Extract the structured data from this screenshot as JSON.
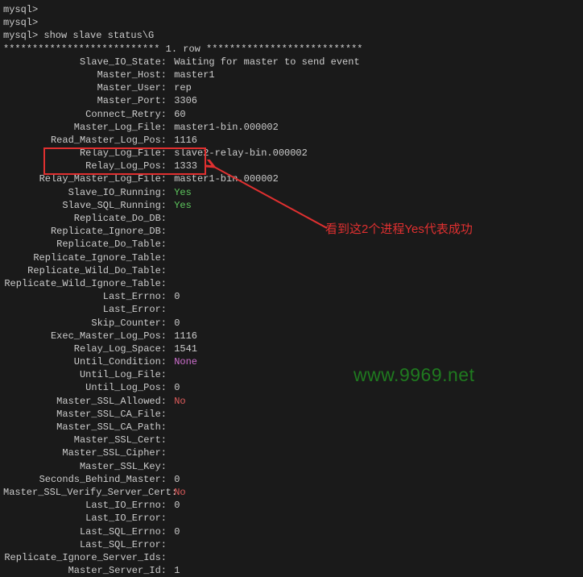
{
  "prompts": [
    "mysql>",
    "mysql>",
    "mysql> show slave status\\G"
  ],
  "row_header": "*************************** 1. row ***************************",
  "fields": [
    {
      "label": "Slave_IO_State",
      "value": "Waiting for master to send event",
      "cls": ""
    },
    {
      "label": "Master_Host",
      "value": "master1",
      "cls": ""
    },
    {
      "label": "Master_User",
      "value": "rep",
      "cls": ""
    },
    {
      "label": "Master_Port",
      "value": "3306",
      "cls": ""
    },
    {
      "label": "Connect_Retry",
      "value": "60",
      "cls": ""
    },
    {
      "label": "Master_Log_File",
      "value": "master1-bin.000002",
      "cls": ""
    },
    {
      "label": "Read_Master_Log_Pos",
      "value": "1116",
      "cls": ""
    },
    {
      "label": "Relay_Log_File",
      "value": "slave2-relay-bin.000002",
      "cls": ""
    },
    {
      "label": "Relay_Log_Pos",
      "value": "1333",
      "cls": ""
    },
    {
      "label": "Relay_Master_Log_File",
      "value": "master1-bin.000002",
      "cls": ""
    },
    {
      "label": "Slave_IO_Running",
      "value": "Yes",
      "cls": "val-green"
    },
    {
      "label": "Slave_SQL_Running",
      "value": "Yes",
      "cls": "val-green"
    },
    {
      "label": "Replicate_Do_DB",
      "value": "",
      "cls": ""
    },
    {
      "label": "Replicate_Ignore_DB",
      "value": "",
      "cls": ""
    },
    {
      "label": "Replicate_Do_Table",
      "value": "",
      "cls": ""
    },
    {
      "label": "Replicate_Ignore_Table",
      "value": "",
      "cls": ""
    },
    {
      "label": "Replicate_Wild_Do_Table",
      "value": "",
      "cls": ""
    },
    {
      "label": "Replicate_Wild_Ignore_Table",
      "value": "",
      "cls": ""
    },
    {
      "label": "Last_Errno",
      "value": "0",
      "cls": ""
    },
    {
      "label": "Last_Error",
      "value": "",
      "cls": ""
    },
    {
      "label": "Skip_Counter",
      "value": "0",
      "cls": ""
    },
    {
      "label": "Exec_Master_Log_Pos",
      "value": "1116",
      "cls": ""
    },
    {
      "label": "Relay_Log_Space",
      "value": "1541",
      "cls": ""
    },
    {
      "label": "Until_Condition",
      "value": "None",
      "cls": "val-magenta"
    },
    {
      "label": "Until_Log_File",
      "value": "",
      "cls": ""
    },
    {
      "label": "Until_Log_Pos",
      "value": "0",
      "cls": ""
    },
    {
      "label": "Master_SSL_Allowed",
      "value": "No",
      "cls": "val-red"
    },
    {
      "label": "Master_SSL_CA_File",
      "value": "",
      "cls": ""
    },
    {
      "label": "Master_SSL_CA_Path",
      "value": "",
      "cls": ""
    },
    {
      "label": "Master_SSL_Cert",
      "value": "",
      "cls": ""
    },
    {
      "label": "Master_SSL_Cipher",
      "value": "",
      "cls": ""
    },
    {
      "label": "Master_SSL_Key",
      "value": "",
      "cls": ""
    },
    {
      "label": "Seconds_Behind_Master",
      "value": "0",
      "cls": ""
    },
    {
      "label": "Master_SSL_Verify_Server_Cert",
      "value": "No",
      "cls": "val-red"
    },
    {
      "label": "Last_IO_Errno",
      "value": "0",
      "cls": ""
    },
    {
      "label": "Last_IO_Error",
      "value": "",
      "cls": ""
    },
    {
      "label": "Last_SQL_Errno",
      "value": "0",
      "cls": ""
    },
    {
      "label": "Last_SQL_Error",
      "value": "",
      "cls": ""
    },
    {
      "label": "Replicate_Ignore_Server_Ids",
      "value": "",
      "cls": ""
    },
    {
      "label": "Master_Server_Id",
      "value": "1",
      "cls": ""
    }
  ],
  "annotation": "看到这2个进程Yes代表成功",
  "watermark": "www.9969.net"
}
